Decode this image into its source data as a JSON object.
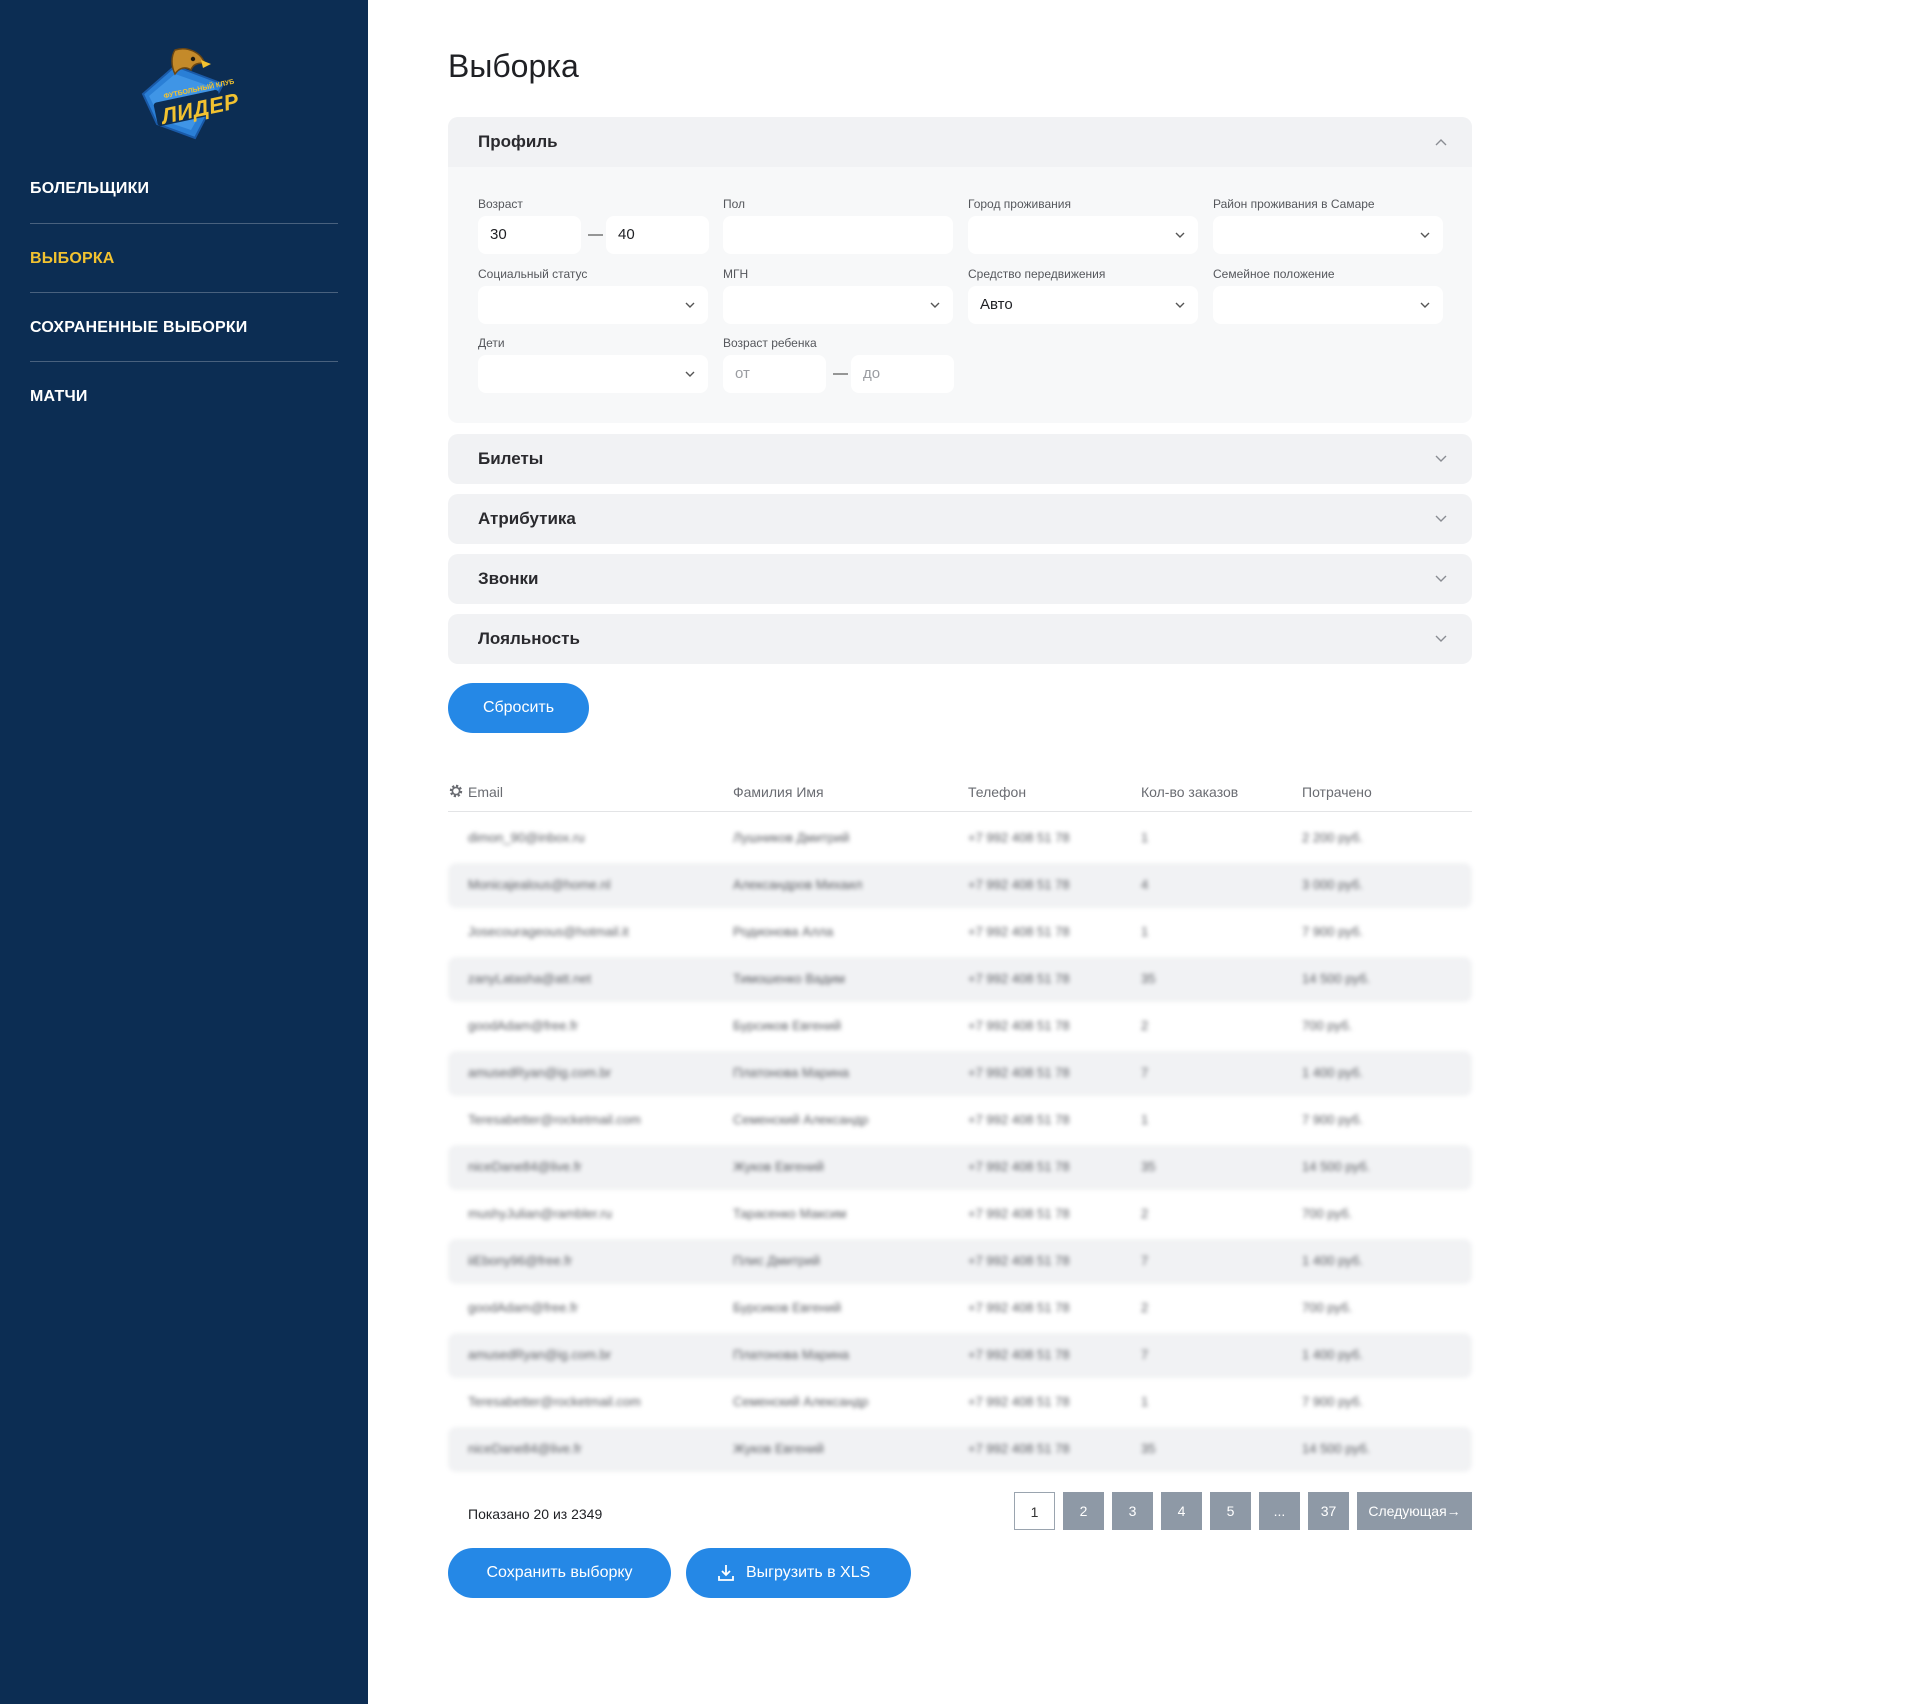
{
  "sidebar": {
    "logo": {
      "top_text": "ФУТБОЛЬНЫЙ КЛУБ",
      "name": "ЛИДЕР"
    },
    "items": [
      {
        "label": "БОЛЕЛЬЩИКИ",
        "active": false
      },
      {
        "label": "ВЫБОРКА",
        "active": true
      },
      {
        "label": "СОХРАНЕННЫЕ ВЫБОРКИ",
        "active": false
      },
      {
        "label": "МАТЧИ",
        "active": false
      }
    ]
  },
  "page": {
    "title": "Выборка"
  },
  "profile": {
    "title": "Профиль",
    "age": {
      "label": "Возраст",
      "from": "30",
      "to": "40"
    },
    "gender": {
      "label": "Пол",
      "value": ""
    },
    "city": {
      "label": "Город проживания",
      "value": ""
    },
    "district": {
      "label": "Район проживания в Самаре",
      "value": ""
    },
    "social": {
      "label": "Социальный статус",
      "value": ""
    },
    "mgn": {
      "label": "МГН",
      "value": ""
    },
    "transport": {
      "label": "Средство передвижения",
      "value": "Авто"
    },
    "family": {
      "label": "Семейное положение",
      "value": ""
    },
    "children": {
      "label": "Дети",
      "value": ""
    },
    "child_age": {
      "label": "Возраст ребенка",
      "from_placeholder": "от",
      "to_placeholder": "до"
    },
    "dash": "—"
  },
  "sections": [
    {
      "title": "Билеты"
    },
    {
      "title": "Атрибутика"
    },
    {
      "title": "Звонки"
    },
    {
      "title": "Лояльность"
    }
  ],
  "reset_label": "Сбросить",
  "table": {
    "columns": [
      "Email",
      "Фамилия Имя",
      "Телефон",
      "Кол-во заказов",
      "Потрачено"
    ],
    "rows": [
      [
        "dimon_90@inbox.ru",
        "Лушников Дмитрий",
        "+7 992 408 51 78",
        "1",
        "2 200 руб."
      ],
      [
        "Monicajealous@home.nl",
        "Александров Михаил",
        "+7 992 408 51 78",
        "4",
        "3 000 руб."
      ],
      [
        "Josecourageous@hotmail.it",
        "Родионова Алла",
        "+7 992 408 51 78",
        "1",
        "7 900 руб."
      ],
      [
        "zanyLatasha@att.net",
        "Тимошенко Вадим",
        "+7 992 408 51 78",
        "35",
        "14 500 руб."
      ],
      [
        "goodAdam@free.fr",
        "Бурсиков Евгений",
        "+7 992 408 51 78",
        "2",
        "700 руб."
      ],
      [
        "amusedRyan@ig.com.br",
        "Платонова Марина",
        "+7 992 408 51 78",
        "7",
        "1 400 руб."
      ],
      [
        "Teresabetter@rocketmail.com",
        "Семенский Александр",
        "+7 992 408 51 78",
        "1",
        "7 900 руб."
      ],
      [
        "niceDane84@live.fr",
        "Жуков Евгений",
        "+7 992 408 51 78",
        "35",
        "14 500 руб."
      ],
      [
        "mushyJulian@rambler.ru",
        "Тарасенко Максим",
        "+7 992 408 51 78",
        "2",
        "700 руб."
      ],
      [
        "iiEbony96@free.fr",
        "Плис Дмитрий",
        "+7 992 408 51 78",
        "7",
        "1 400 руб."
      ],
      [
        "goodAdam@free.fr",
        "Бурсиков Евгений",
        "+7 992 408 51 78",
        "2",
        "700 руб."
      ],
      [
        "amusedRyan@ig.com.br",
        "Платонова Марина",
        "+7 992 408 51 78",
        "7",
        "1 400 руб."
      ],
      [
        "Teresabetter@rocketmail.com",
        "Семенский Александр",
        "+7 992 408 51 78",
        "1",
        "7 900 руб."
      ],
      [
        "niceDane84@live.fr",
        "Жуков Евгений",
        "+7 992 408 51 78",
        "35",
        "14 500 руб."
      ]
    ]
  },
  "pagination": {
    "shown_text": "Показано 20 из 2349",
    "pages": [
      "1",
      "2",
      "3",
      "4",
      "5",
      "...",
      "37"
    ],
    "current": "1",
    "next_label": "Следующая→"
  },
  "actions": {
    "save_label": "Сохранить выборку",
    "export_label": "Выгрузить в XLS"
  },
  "colors": {
    "sidebar_bg": "#0c2d53",
    "active_nav": "#f2c230",
    "accent": "#2588e6",
    "pager": "#8e99a6"
  }
}
